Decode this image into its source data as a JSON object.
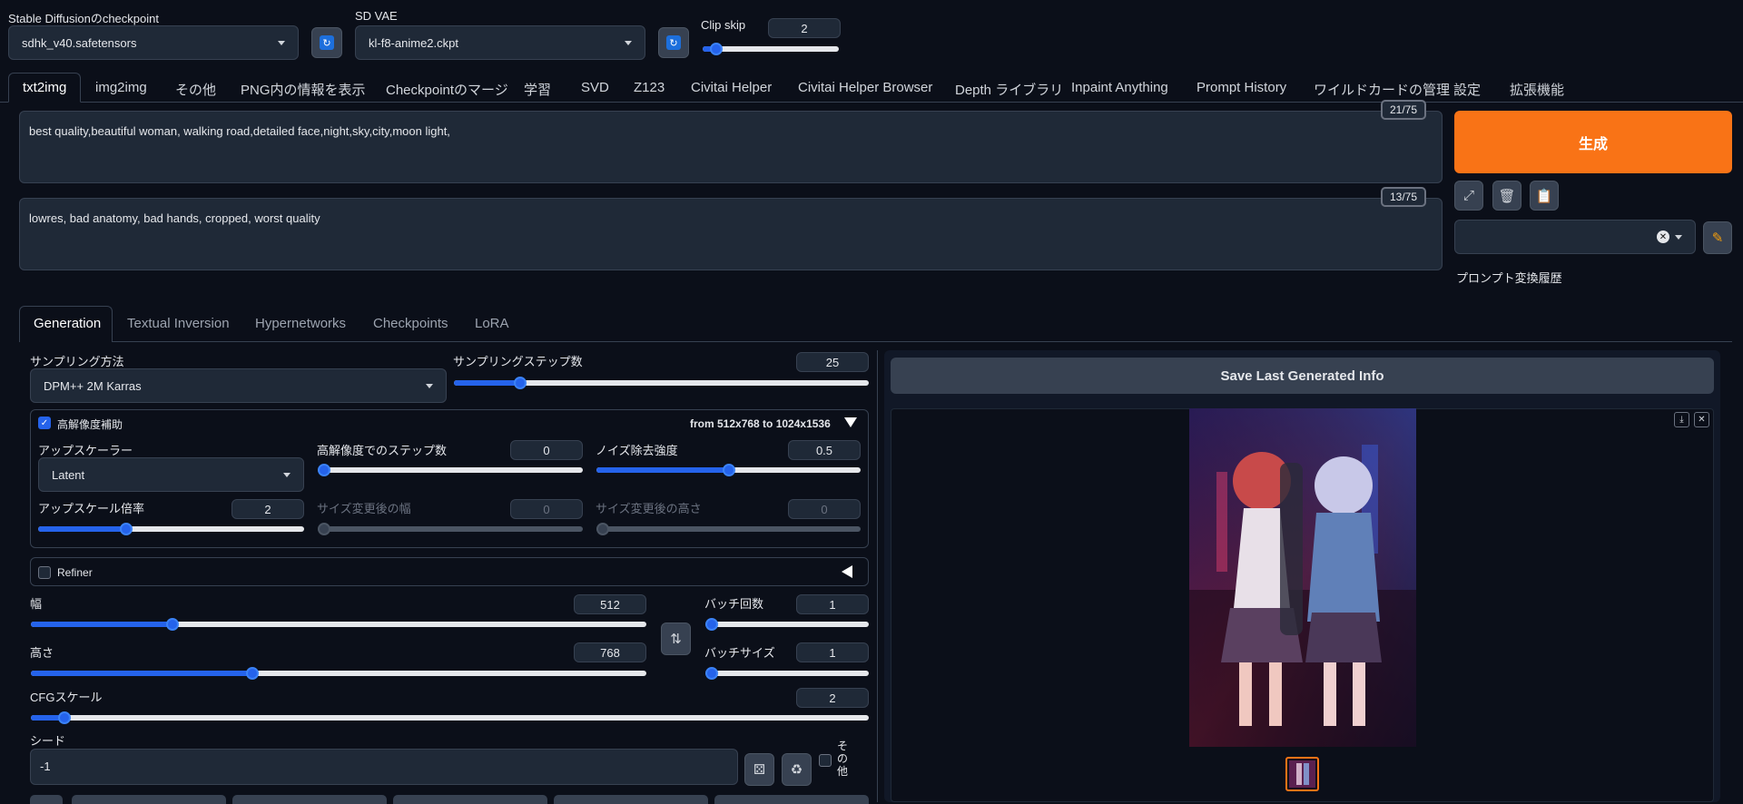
{
  "top": {
    "checkpoint_label": "Stable Diffusionのcheckpoint",
    "checkpoint_value": "sdhk_v40.safetensors",
    "vae_label": "SD VAE",
    "vae_value": "kl-f8-anime2.ckpt",
    "clip_label": "Clip skip",
    "clip_value": "2",
    "clip_fraction": 0.1
  },
  "tabs": [
    "txt2img",
    "img2img",
    "その他",
    "PNG内の情報を表示",
    "Checkpointのマージ",
    "学習",
    "SVD",
    "Z123",
    "Civitai Helper",
    "Civitai Helper Browser",
    "Depth ライブラリ",
    "Inpaint Anything",
    "Prompt History",
    "ワイルドカードの管理",
    "設定",
    "拡張機能"
  ],
  "prompt": {
    "positive": "best quality,beautiful woman, walking road,detailed face,night,sky,city,moon light,",
    "positive_count": "21/75",
    "negative": "lowres, bad anatomy, bad hands, cropped, worst quality",
    "negative_count": "13/75"
  },
  "generate_label": "生成",
  "history_label": "プロンプト変換履歴",
  "subtabs": [
    "Generation",
    "Textual Inversion",
    "Hypernetworks",
    "Checkpoints",
    "LoRA"
  ],
  "sampling": {
    "method_label": "サンプリング方法",
    "method_value": "DPM++ 2M Karras",
    "steps_label": "サンプリングステップ数",
    "steps_value": "25",
    "steps_fraction": 0.16
  },
  "hires": {
    "label": "高解像度補助",
    "from_to": "from 512x768  to 1024x1536",
    "upscaler_label": "アップスケーラー",
    "upscaler_value": "Latent",
    "steps_label": "高解像度でのステップ数",
    "steps_value": "0",
    "steps_fraction": 0,
    "denoise_label": "ノイズ除去強度",
    "denoise_value": "0.5",
    "denoise_fraction": 0.5,
    "scale_label": "アップスケール倍率",
    "scale_value": "2",
    "scale_fraction": 0.33,
    "resize_w_label": "サイズ変更後の幅",
    "resize_w_value": "0",
    "resize_h_label": "サイズ変更後の高さ",
    "resize_h_value": "0"
  },
  "refiner_label": "Refiner",
  "size": {
    "width_label": "幅",
    "width_value": "512",
    "width_fraction": 0.23,
    "height_label": "高さ",
    "height_value": "768",
    "height_fraction": 0.36,
    "batch_count_label": "バッチ回数",
    "batch_count_value": "1",
    "batch_size_label": "バッチサイズ",
    "batch_size_value": "1",
    "swap_icon": "⇅"
  },
  "cfg": {
    "label": "CFGスケール",
    "value": "2",
    "fraction": 0.04
  },
  "seed": {
    "label": "シード",
    "value": "-1",
    "other_label": "その他"
  },
  "output": {
    "save_label": "Save Last Generated Info"
  },
  "colors": {
    "accent": "#f97316",
    "slider": "#2563eb",
    "bg": "#0b0f19"
  }
}
